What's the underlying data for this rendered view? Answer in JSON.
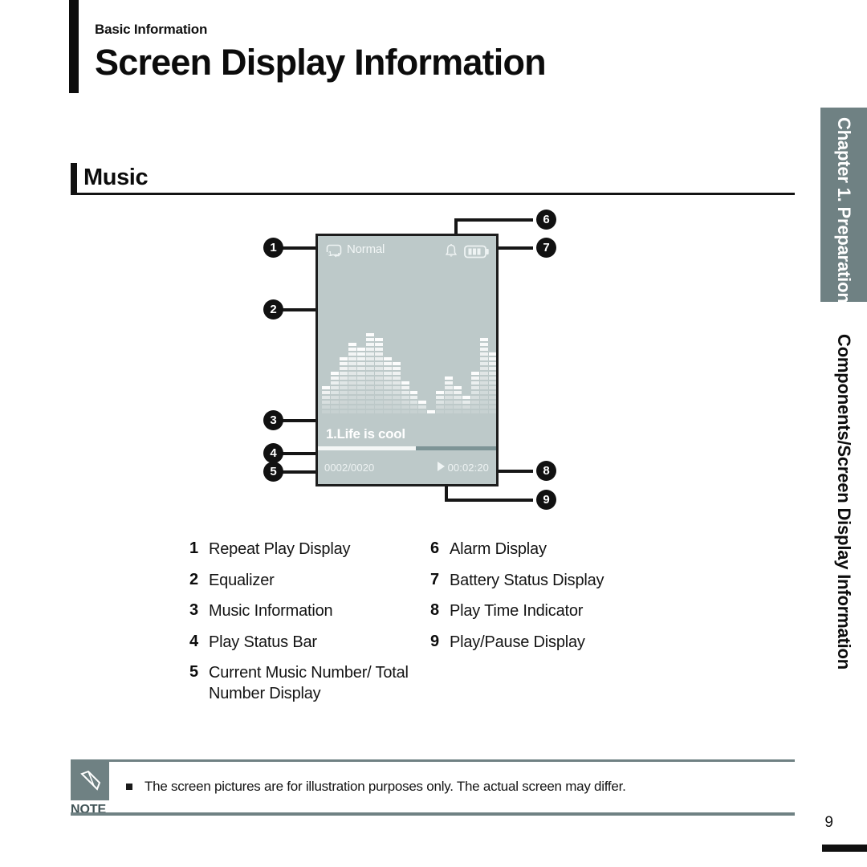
{
  "header": {
    "eyebrow": "Basic Information",
    "title": "Screen Display Information"
  },
  "section": {
    "title": "Music"
  },
  "chapter_tab": {
    "label": "Chapter 1. Preparation",
    "sub_label": "Components/Screen Display Information",
    "tab_color": "#6f8183"
  },
  "device": {
    "screen_bg": "#bdc9c9",
    "status": {
      "repeat_icon": "repeat-one-icon",
      "repeat_mode": "Normal",
      "alarm_icon": "alarm-bell-icon",
      "battery_icon": "battery-full-icon",
      "battery_level": 3
    },
    "music": {
      "title": "1.Life is cool",
      "track_counter": "0002/0020",
      "play_time": "00:02:20",
      "play_icon": "play-triangle-icon",
      "progress_percent": 55
    },
    "equalizer": {
      "bar_count": 20,
      "levels": [
        6,
        9,
        12,
        15,
        14,
        17,
        16,
        12,
        11,
        7,
        5,
        3,
        1,
        5,
        8,
        6,
        4,
        9,
        16,
        13
      ]
    }
  },
  "callouts": [
    {
      "number": "1",
      "target": "repeat-play-display"
    },
    {
      "number": "2",
      "target": "equalizer"
    },
    {
      "number": "3",
      "target": "music-information"
    },
    {
      "number": "4",
      "target": "play-status-bar"
    },
    {
      "number": "5",
      "target": "current-music-number"
    },
    {
      "number": "6",
      "target": "alarm-display"
    },
    {
      "number": "7",
      "target": "battery-status-display"
    },
    {
      "number": "8",
      "target": "play-time-indicator"
    },
    {
      "number": "9",
      "target": "play-pause-display"
    }
  ],
  "legend": {
    "left": [
      {
        "num": "1",
        "label": "Repeat Play Display"
      },
      {
        "num": "2",
        "label": "Equalizer"
      },
      {
        "num": "3",
        "label": "Music Information"
      },
      {
        "num": "4",
        "label": "Play Status Bar"
      },
      {
        "num": "5",
        "label": "Current Music Number/ Total Number Display"
      }
    ],
    "right": [
      {
        "num": "6",
        "label": "Alarm Display"
      },
      {
        "num": "7",
        "label": "Battery Status Display"
      },
      {
        "num": "8",
        "label": "Play Time Indicator"
      },
      {
        "num": "9",
        "label": "Play/Pause Display"
      }
    ]
  },
  "note": {
    "label": "NOTE",
    "icon": "pencil-icon",
    "text": "The screen pictures are for illustration purposes only. The actual screen may differ."
  },
  "footer": {
    "page_number": "9"
  }
}
